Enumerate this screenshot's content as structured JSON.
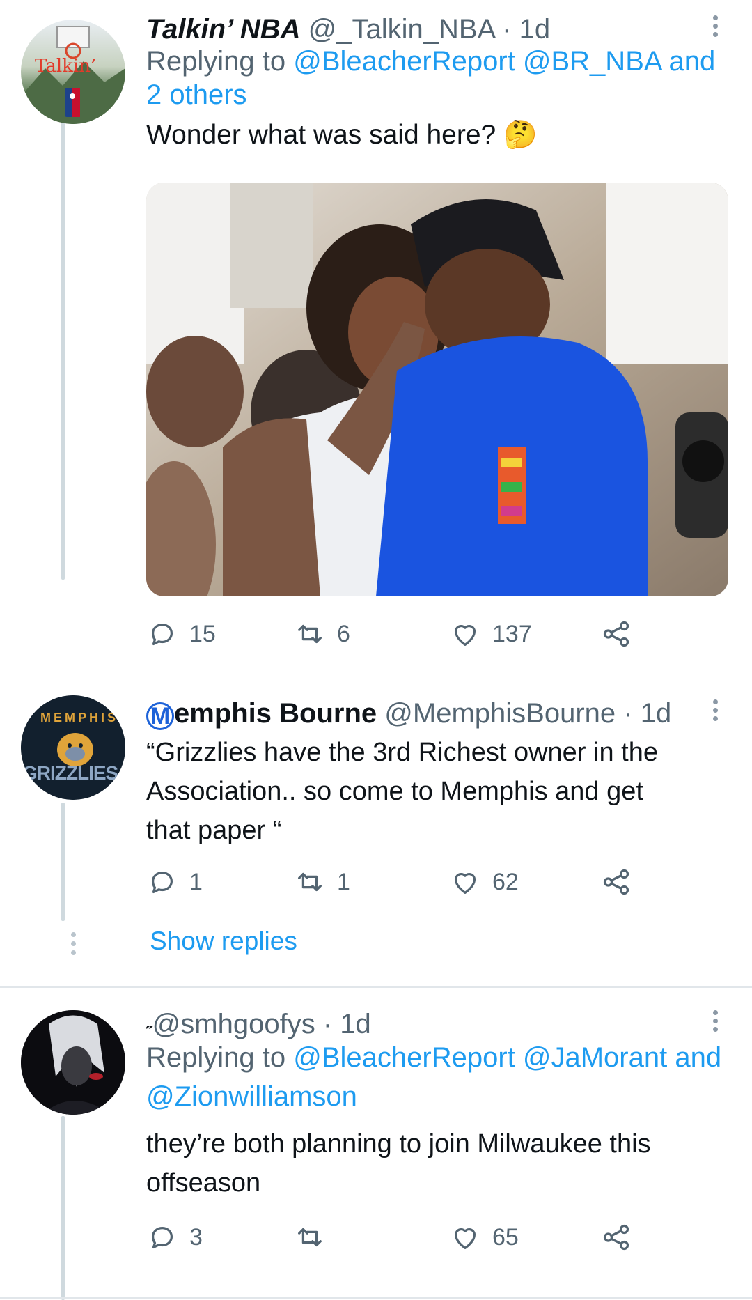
{
  "tweets": [
    {
      "display_name": "Talkin’ NBA",
      "handle": "@_Talkin_NBA",
      "time": "· 1d",
      "replying_prefix": "Replying to ",
      "replying_line1": "@BleacherReport @BR_NBA and",
      "replying_line2": "2 others",
      "text": "Wonder what was said here?",
      "emoji": "🤔",
      "avatar_text": "Talkin’",
      "actions": {
        "replies": "15",
        "retweets": "6",
        "likes": "137"
      }
    },
    {
      "display_name_initial": "M",
      "display_name_rest": "emphis Bourne",
      "handle": "@MemphisBourne",
      "time": "· 1d",
      "text_lines": [
        "“Grizzlies have the 3rd Richest owner in the",
        "Association.. so come to Memphis and get",
        "that paper “"
      ],
      "avatar_top_text": "MEMPHIS",
      "avatar_bottom_text": "GRIZZLIES",
      "actions": {
        "replies": "1",
        "retweets": "1",
        "likes": "62"
      }
    },
    {
      "name_mark": "˶",
      "handle": "@smhgoofys",
      "time": "· 1d",
      "replying_prefix": "Replying to ",
      "replying_line1": "@BleacherReport @JaMorant and",
      "replying_line2": "@Zionwilliamson",
      "text_lines": [
        "they’re both planning to join Milwaukee this",
        "offseason"
      ],
      "actions": {
        "replies": "3",
        "retweets": "",
        "likes": "65"
      }
    }
  ],
  "show_replies_label": "Show replies",
  "icons": [
    "reply-icon",
    "retweet-icon",
    "like-icon",
    "share-icon",
    "more-icon"
  ],
  "colors": {
    "link": "#1d9bf0",
    "secondary": "#536471",
    "thread_line": "#cfd9de",
    "photo_jersey": "#1a54e0"
  }
}
